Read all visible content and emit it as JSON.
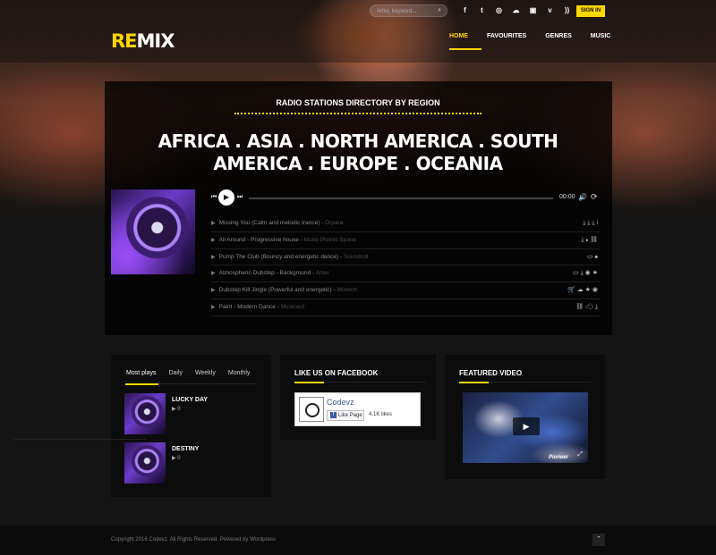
{
  "header": {
    "search_placeholder": "Artist, keyword...",
    "socials": [
      "facebook-icon",
      "twitter-icon",
      "instagram-icon",
      "soundcloud-icon",
      "twitch-icon",
      "vimeo-icon",
      "rss-icon"
    ],
    "social_glyphs": [
      "f",
      "t",
      "◎",
      "☁",
      "▣",
      "v",
      "))"
    ],
    "sign_in": "SIGN IN",
    "logo_accent": "RE",
    "logo_rest": "MIX",
    "nav": [
      "HOME",
      "FAVOURITES",
      "GENRES",
      "MUSIC"
    ]
  },
  "main": {
    "section_title": "RADIO STATIONS DIRECTORY BY REGION",
    "regions": "AFRICA . ASIA . NORTH AMERICA . SOUTH AMERICA . EUROPE . OCEANIA",
    "player": {
      "time": "00:00"
    },
    "tracks": [
      {
        "title": "Missing You (Calm and melodic trance)",
        "artist": "Orpara",
        "icons": "⤓ ⤓ ⤓ i"
      },
      {
        "title": "All Around - Progressive house",
        "artist": "Mono Phonic Space",
        "icons": "⤓  ⦁ ⛓"
      },
      {
        "title": "Pump The Club (Bouncy and energetic dance)",
        "artist": "Soundroll",
        "icons": "▭  ⦁"
      },
      {
        "title": "Atmospheric Dubstep - Background",
        "artist": "Artax",
        "icons": "▭ ⤓ ◉ ★"
      },
      {
        "title": "Dubstep Kill Jingle (Powerful and energetic)",
        "artist": "Mixtech",
        "icons": "🛒 ☁ ★ ◉"
      },
      {
        "title": "Paint - Modern Dance",
        "artist": "Musicard",
        "icons": "⛓ ☁ ⤓"
      }
    ]
  },
  "widgets": {
    "most_plays": {
      "tabs": [
        "Most plays",
        "Daily",
        "Weekly",
        "Monthly"
      ],
      "items": [
        {
          "title": "LUCKY DAY",
          "plays": "▶ 0"
        },
        {
          "title": "DESTINY",
          "plays": "▶ 0"
        }
      ]
    },
    "facebook": {
      "title": "LIKE US ON FACEBOOK",
      "page_name": "Codevz",
      "like_label": "Like Page",
      "likes": "4.1K likes"
    },
    "video": {
      "title": "FEATURED VIDEO",
      "brand": "Pioneer"
    }
  },
  "footer": {
    "copyright": "Copyright 2016 Codevz. All Rights Reserved. Powered by Wordpress"
  },
  "colors": {
    "accent": "#ffd700",
    "panel": "#0c0c0c"
  }
}
